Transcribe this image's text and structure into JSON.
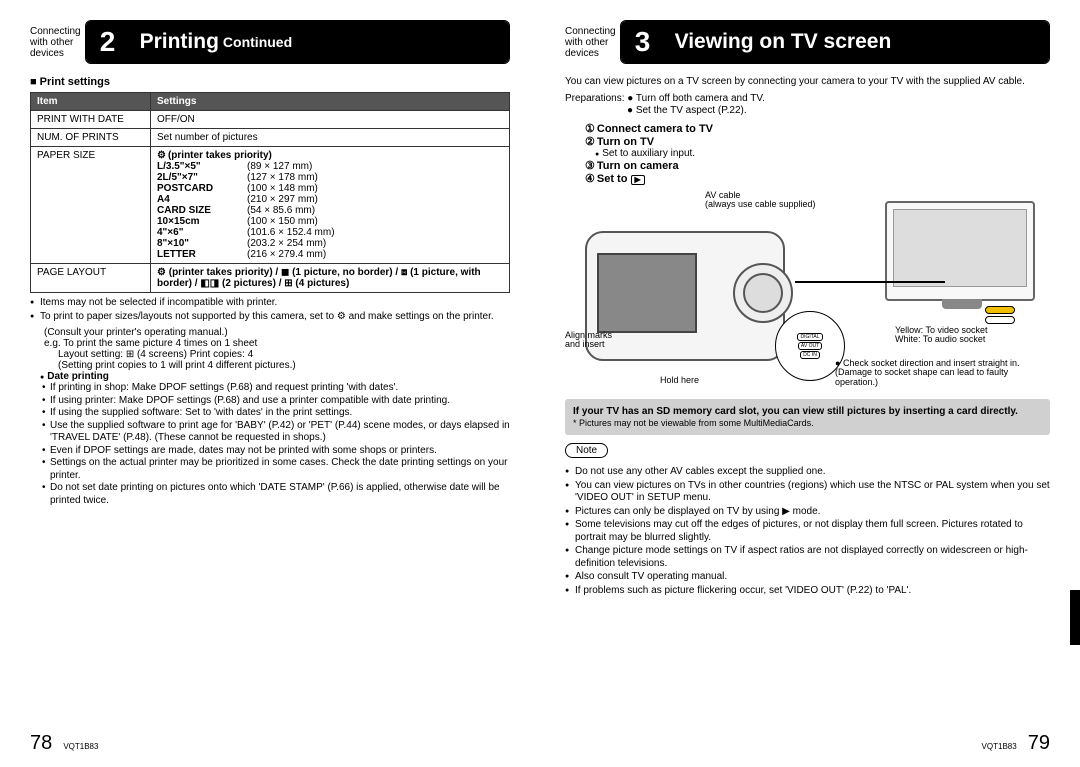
{
  "left": {
    "preLabel": "Connecting\nwith other\ndevices",
    "stepNum": "2",
    "title": "Printing",
    "titleSuffix": "Continued",
    "printSettingsHeader": "Print settings",
    "table": {
      "headItem": "Item",
      "headSettings": "Settings",
      "rows": {
        "printWithDate": {
          "item": "PRINT WITH DATE",
          "val": "OFF/ON"
        },
        "numOfPrints": {
          "item": "NUM. OF PRINTS",
          "val": "Set number of pictures"
        },
        "paperSize": {
          "item": "PAPER SIZE",
          "priority": "(printer takes priority)",
          "sizes": [
            {
              "k": "L/3.5\"×5\"",
              "v": "(89 × 127 mm)"
            },
            {
              "k": "2L/5\"×7\"",
              "v": "(127 × 178 mm)"
            },
            {
              "k": "POSTCARD",
              "v": "(100 × 148 mm)"
            },
            {
              "k": "A4",
              "v": "(210 × 297 mm)"
            },
            {
              "k": "CARD SIZE",
              "v": "(54 × 85.6 mm)"
            },
            {
              "k": "10×15cm",
              "v": "(100 × 150 mm)"
            },
            {
              "k": "4\"×6\"",
              "v": "(101.6 × 152.4 mm)"
            },
            {
              "k": "8\"×10\"",
              "v": "(203.2 × 254 mm)"
            },
            {
              "k": "LETTER",
              "v": "(216 × 279.4 mm)"
            }
          ]
        },
        "pageLayout": {
          "item": "PAGE LAYOUT",
          "val": "⚙ (printer takes priority) / ◼ (1 picture, no border) / ⧈ (1 picture, with border) / ◧◨ (2 pictures) / ⊞ (4 pictures)"
        }
      }
    },
    "notes": [
      "Items may not be selected if incompatible with printer.",
      "To print to paper sizes/layouts not supported by this camera, set to ⚙ and make settings on the printer.",
      "(Consult your printer's operating manual.)"
    ],
    "example": {
      "line1": "e.g. To print the same picture 4 times on 1 sheet",
      "line2": "Layout setting: ⊞ (4 screens)  Print copies: 4",
      "line3": "(Setting print copies to 1 will print 4 different pictures.)"
    },
    "datePrinting": {
      "header": "Date printing",
      "items": [
        "If printing in shop: Make DPOF settings (P.68) and request printing 'with dates'.",
        "If using printer: Make DPOF settings (P.68) and use a printer compatible with date printing.",
        "If using the supplied software: Set to 'with dates' in the print settings.",
        "Use the supplied software to print age for 'BABY' (P.42) or 'PET' (P.44) scene modes, or days elapsed in 'TRAVEL DATE' (P.48). (These cannot be requested in shops.)",
        "Even if DPOF settings are made, dates may not be printed with some shops or printers.",
        "Settings on the actual printer may be prioritized in some cases. Check the date printing settings on your printer.",
        "Do not set date printing on pictures onto which 'DATE STAMP' (P.66) is applied, otherwise date will be printed twice."
      ]
    },
    "pageNum": "78",
    "docId": "VQT1B83"
  },
  "right": {
    "preLabel": "Connecting\nwith other\ndevices",
    "stepNum": "3",
    "title": "Viewing on TV screen",
    "intro": "You can view pictures on a TV screen by connecting your camera to your TV with the supplied AV cable.",
    "prepLabel": "Preparations:",
    "prep1": "Turn off both camera and TV.",
    "prep2": "Set the TV aspect (P.22).",
    "steps": {
      "s1": "Connect camera to TV",
      "s2": "Turn on TV",
      "s2sub": "Set to auxiliary input.",
      "s3": "Turn on camera",
      "s4pre": "Set to",
      "s4icon": "▶"
    },
    "diagram": {
      "avcable": "AV cable",
      "avcable2": "(always use cable supplied)",
      "yellow": "Yellow: To video socket",
      "white": "White: To audio socket",
      "align": "Align marks\nand insert",
      "hold": "Hold here",
      "digital": "DIGITAL",
      "avout": "AV OUT",
      "dcin": "DC IN",
      "check": "Check socket direction and insert straight in. (Damage to socket shape can lead to faulty operation.)"
    },
    "sdbox": {
      "line1": "If your TV has an SD memory card slot, you can view still pictures by inserting a card directly.",
      "line2": "* Pictures may not be viewable from some MultiMediaCards."
    },
    "noteLabel": "Note",
    "notes": [
      "Do not use any other AV cables except the supplied one.",
      "You can view pictures on TVs in other countries (regions) which use the NTSC or PAL system when you set 'VIDEO OUT' in SETUP menu.",
      "Pictures can only be displayed on TV by using ▶ mode.",
      "Some televisions may cut off the edges of pictures, or not display them full screen. Pictures rotated to portrait may be blurred slightly.",
      "Change picture mode settings on TV if aspect ratios are not displayed correctly on widescreen or high-definition televisions.",
      "Also consult TV operating manual.",
      "If problems such as picture flickering occur, set 'VIDEO OUT' (P.22) to 'PAL'."
    ],
    "pageNum": "79",
    "docId": "VQT1B83"
  }
}
